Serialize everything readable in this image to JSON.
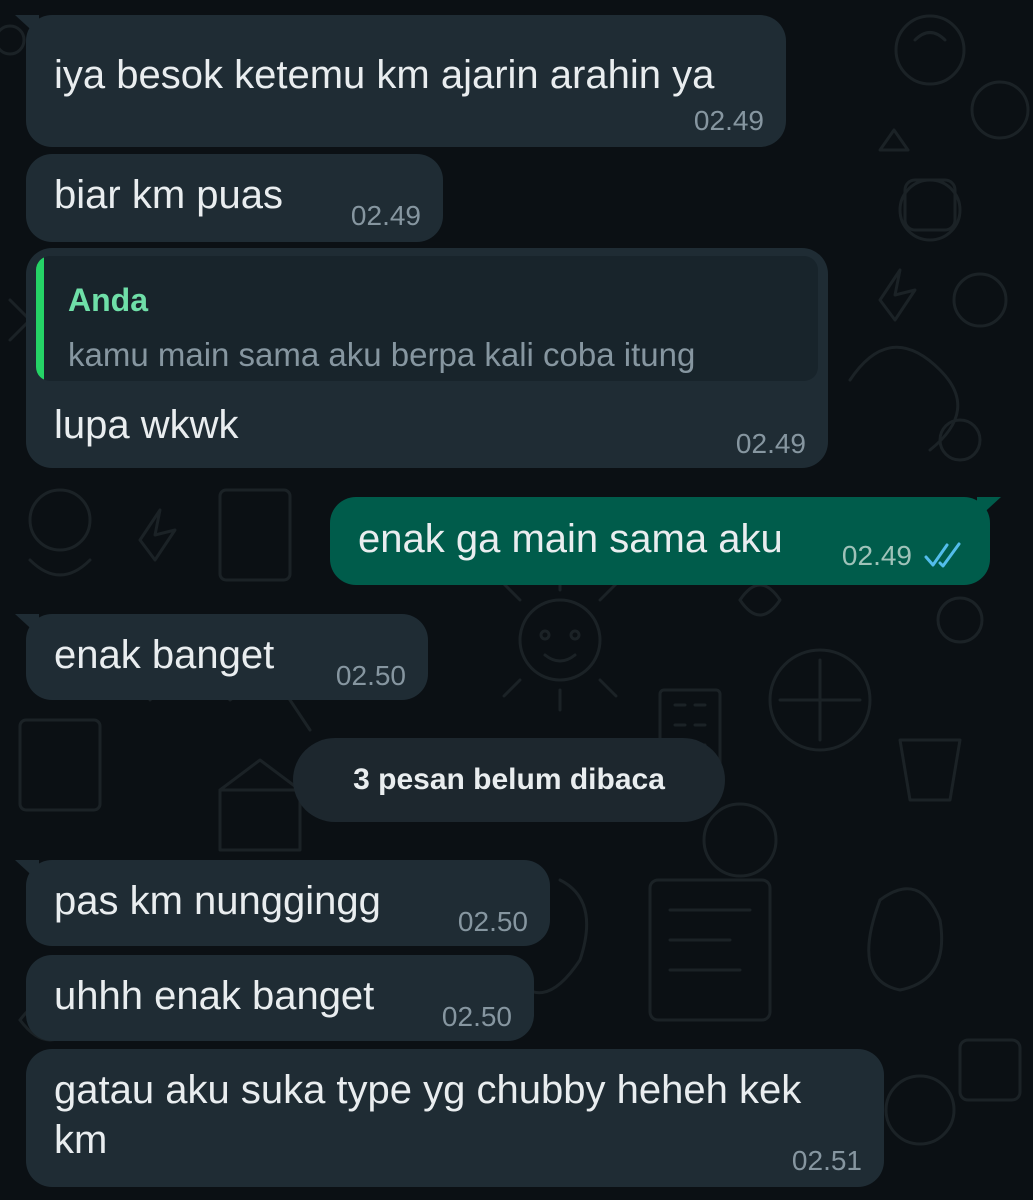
{
  "messages": [
    {
      "text": "iya besok ketemu km ajarin arahin ya",
      "time": "02.49"
    },
    {
      "text": "biar km puas",
      "time": "02.49"
    },
    {
      "quote_author": "Anda",
      "quote_text": "kamu main sama aku berpa kali coba itung",
      "text": "lupa wkwk",
      "time": "02.49"
    },
    {
      "text": "enak ga main sama aku",
      "time": "02.49",
      "status": "read"
    },
    {
      "text": "enak banget",
      "time": "02.50"
    },
    {
      "text": "pas km nunggingg",
      "time": "02.50"
    },
    {
      "text": "uhhh enak banget",
      "time": "02.50"
    },
    {
      "text_line1": "gatau aku suka type yg chubby heheh kek",
      "text_line2": "km",
      "time": "02.51"
    }
  ],
  "unread_label": "3 pesan belum dibaca",
  "colors": {
    "background": "#0b1014",
    "incoming_bubble": "#1f2c34",
    "outgoing_bubble": "#005c4b",
    "quote_accent": "#25d366",
    "read_ticks": "#53bdeb"
  },
  "icons": [
    "double-check-icon"
  ]
}
